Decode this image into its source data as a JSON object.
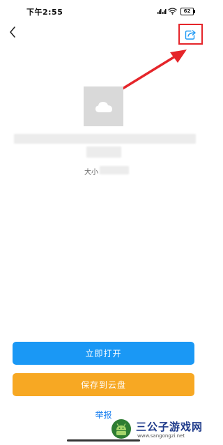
{
  "status_bar": {
    "time": "下午2:55",
    "battery": "62"
  },
  "nav": {
    "back_icon": "chevron-left-icon",
    "share_icon": "share-icon"
  },
  "file": {
    "thumb_icon": "cloud-icon",
    "size_label": "大小"
  },
  "actions": {
    "open_label": "立即打开",
    "save_label": "保存到云盘",
    "report_label": "举报"
  },
  "watermark": {
    "title": "三公子游戏网",
    "url": "www.sangongzi.net"
  },
  "colors": {
    "open_button": "#1a98f5",
    "save_button": "#f7a823",
    "annotation": "#e5252a",
    "link": "#1a7ff0"
  }
}
